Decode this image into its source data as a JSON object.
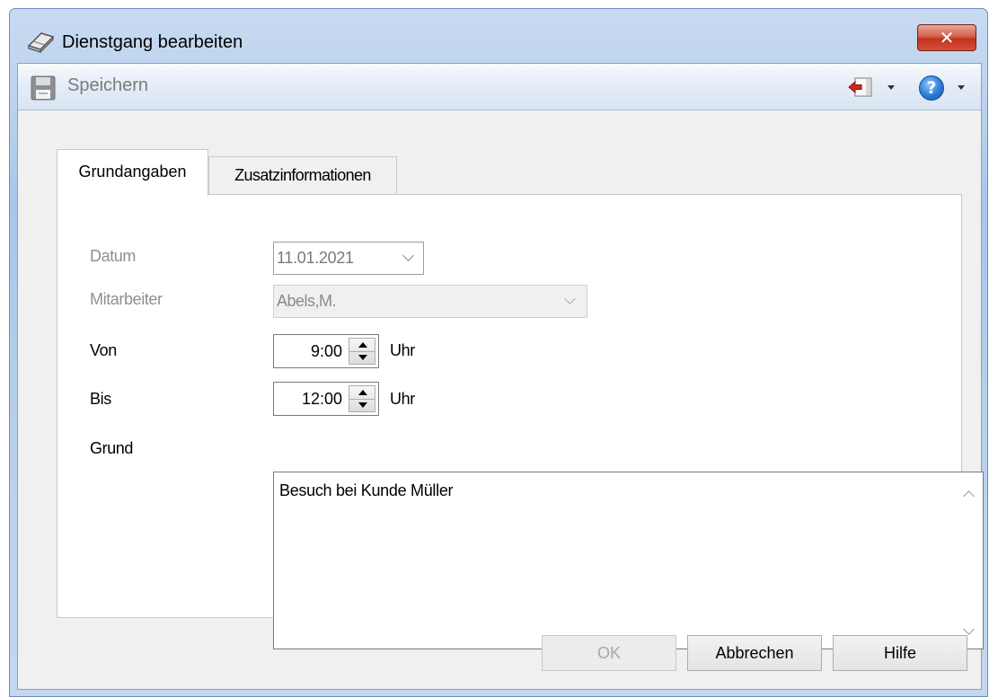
{
  "window": {
    "title": "Dienstgang bearbeiten",
    "close_label": "✕"
  },
  "toolbar": {
    "save_label": "Speichern",
    "help_label": "?"
  },
  "tabs": [
    {
      "label": "Grundangaben",
      "active": true
    },
    {
      "label": "Zusatzinformationen",
      "active": false
    }
  ],
  "form": {
    "datum": {
      "label": "Datum",
      "value": "11.01.2021"
    },
    "mitarbeiter": {
      "label": "Mitarbeiter",
      "value": "Abels,M."
    },
    "von": {
      "label": "Von",
      "value": "9:00",
      "unit": "Uhr"
    },
    "bis": {
      "label": "Bis",
      "value": "12:00",
      "unit": "Uhr"
    },
    "grund": {
      "label": "Grund",
      "value": "Besuch bei Kunde Müller"
    }
  },
  "buttons": {
    "ok": "OK",
    "cancel": "Abbrechen",
    "help": "Hilfe"
  },
  "colors": {
    "close_button": "#c2331c",
    "toolbar_bg": "#e4ecf7",
    "disabled_text": "#8f8f8f"
  }
}
